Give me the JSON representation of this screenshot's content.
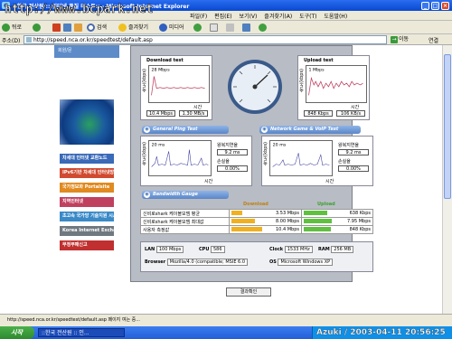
{
  "window": {
    "title": "::한국 전산원 :: 인터넷 품질 테스트:: - Microsoft Internet Explorer",
    "watermark": "http://www.bcpark.net"
  },
  "menu": [
    "파일(F)",
    "편집(E)",
    "보기(V)",
    "즐겨찾기(A)",
    "도구(T)",
    "도움말(H)"
  ],
  "toolbar": {
    "back": "뒤로",
    "search": "검색",
    "favorites": "즐겨찾기",
    "media": "미디어"
  },
  "address": {
    "label": "주소(D)",
    "url": "http://speed.nca.or.kr/speedtest/default.asp",
    "go": "이동",
    "links": "연결"
  },
  "sidebar": {
    "top": "회원/문",
    "buttons": [
      {
        "label": "차세대 인터넷 교환노드",
        "color": "#3a6ab8"
      },
      {
        "label": "IPv6기반 차세대 인터넷망",
        "color": "#d04a30"
      },
      {
        "label": "국가정보화 Portalsite",
        "color": "#e08a20"
      },
      {
        "label": "지역인터넷",
        "color": "#c04060"
      },
      {
        "label": "초고속 국가망 기술지원 시스템",
        "color": "#3a8ac8"
      },
      {
        "label": "Korea Internet Exchange",
        "color": "#707880"
      },
      {
        "label": "무정부패신고",
        "color": "#c03030"
      }
    ]
  },
  "download": {
    "title": "Download test",
    "ymax": "28 Mbps",
    "x_label": "시간",
    "y_label": "속도(kbps)",
    "speed_mbps": "10.4 Mbps",
    "speed_mBps": "1.30 MB/s"
  },
  "upload": {
    "title": "Upload test",
    "ymax": "1 Mbps",
    "x_label": "시간",
    "y_label": "속도(kbps)",
    "speed_kbps": "848 Kbps",
    "speed_kBps": "106 KB/s"
  },
  "ping": {
    "header": "General Ping Test",
    "ymax": "20 ms",
    "x_label": "시간",
    "y_label": "속도(kbps)",
    "rtt_label": "왕복지연율",
    "rtt": "9.2 ms",
    "loss_label": "손실율",
    "loss": "0.00%"
  },
  "voip": {
    "header": "Network Game & VoIP Test",
    "ymax": "20 ms",
    "x_label": "시간",
    "y_label": "속도(kbps)",
    "rtt_label": "왕복지연율",
    "rtt": "9.2 ms",
    "loss_label": "손실율",
    "loss": "0.00%"
  },
  "bandwidth": {
    "header": "Bandwidth Gauge",
    "download_label": "Download",
    "upload_label": "Upload",
    "rows": [
      {
        "label": "신비로shark 케이블모뎀 평균",
        "down": "3.53 Mbps",
        "up": "638 Kbps",
        "down_frac": 0.34,
        "up_frac": 0.75
      },
      {
        "label": "신비로shark 케이블모뎀 최대값",
        "down": "8.00 Mbps",
        "up": "7.95 Mbps",
        "down_frac": 0.77,
        "up_frac": 0.9
      },
      {
        "label": "사용자 측정값",
        "down": "10.4 Mbps",
        "up": "848 Kbps",
        "down_frac": 1.0,
        "up_frac": 0.88
      }
    ]
  },
  "system": {
    "lan_label": "LAN",
    "lan": "100 Mbps",
    "cpu_label": "CPU",
    "cpu": "586",
    "clock_label": "Clock",
    "clock": "1533 MHz",
    "ram_label": "RAM",
    "ram": "256 MB",
    "browser_label": "Browser",
    "browser": "Mozilla/4.0 (compatible; MSIE 6.0",
    "os_label": "OS",
    "os": "Microsoft Windows XP"
  },
  "confirm_button": "결과확인",
  "statusbar": "http://speed.nca.or.kr/speedtest/default.asp 페이지 여는 중...",
  "taskbar": {
    "start": "시작",
    "task": "::한국 전산원 :: 인...",
    "datetime": "Azuki / 2003-04-11 20:56:25"
  },
  "colors": {
    "download_bar": "#f0b020",
    "upload_bar": "#60c040",
    "chart_line": "#4040a0",
    "upload_line": "#c04060"
  }
}
